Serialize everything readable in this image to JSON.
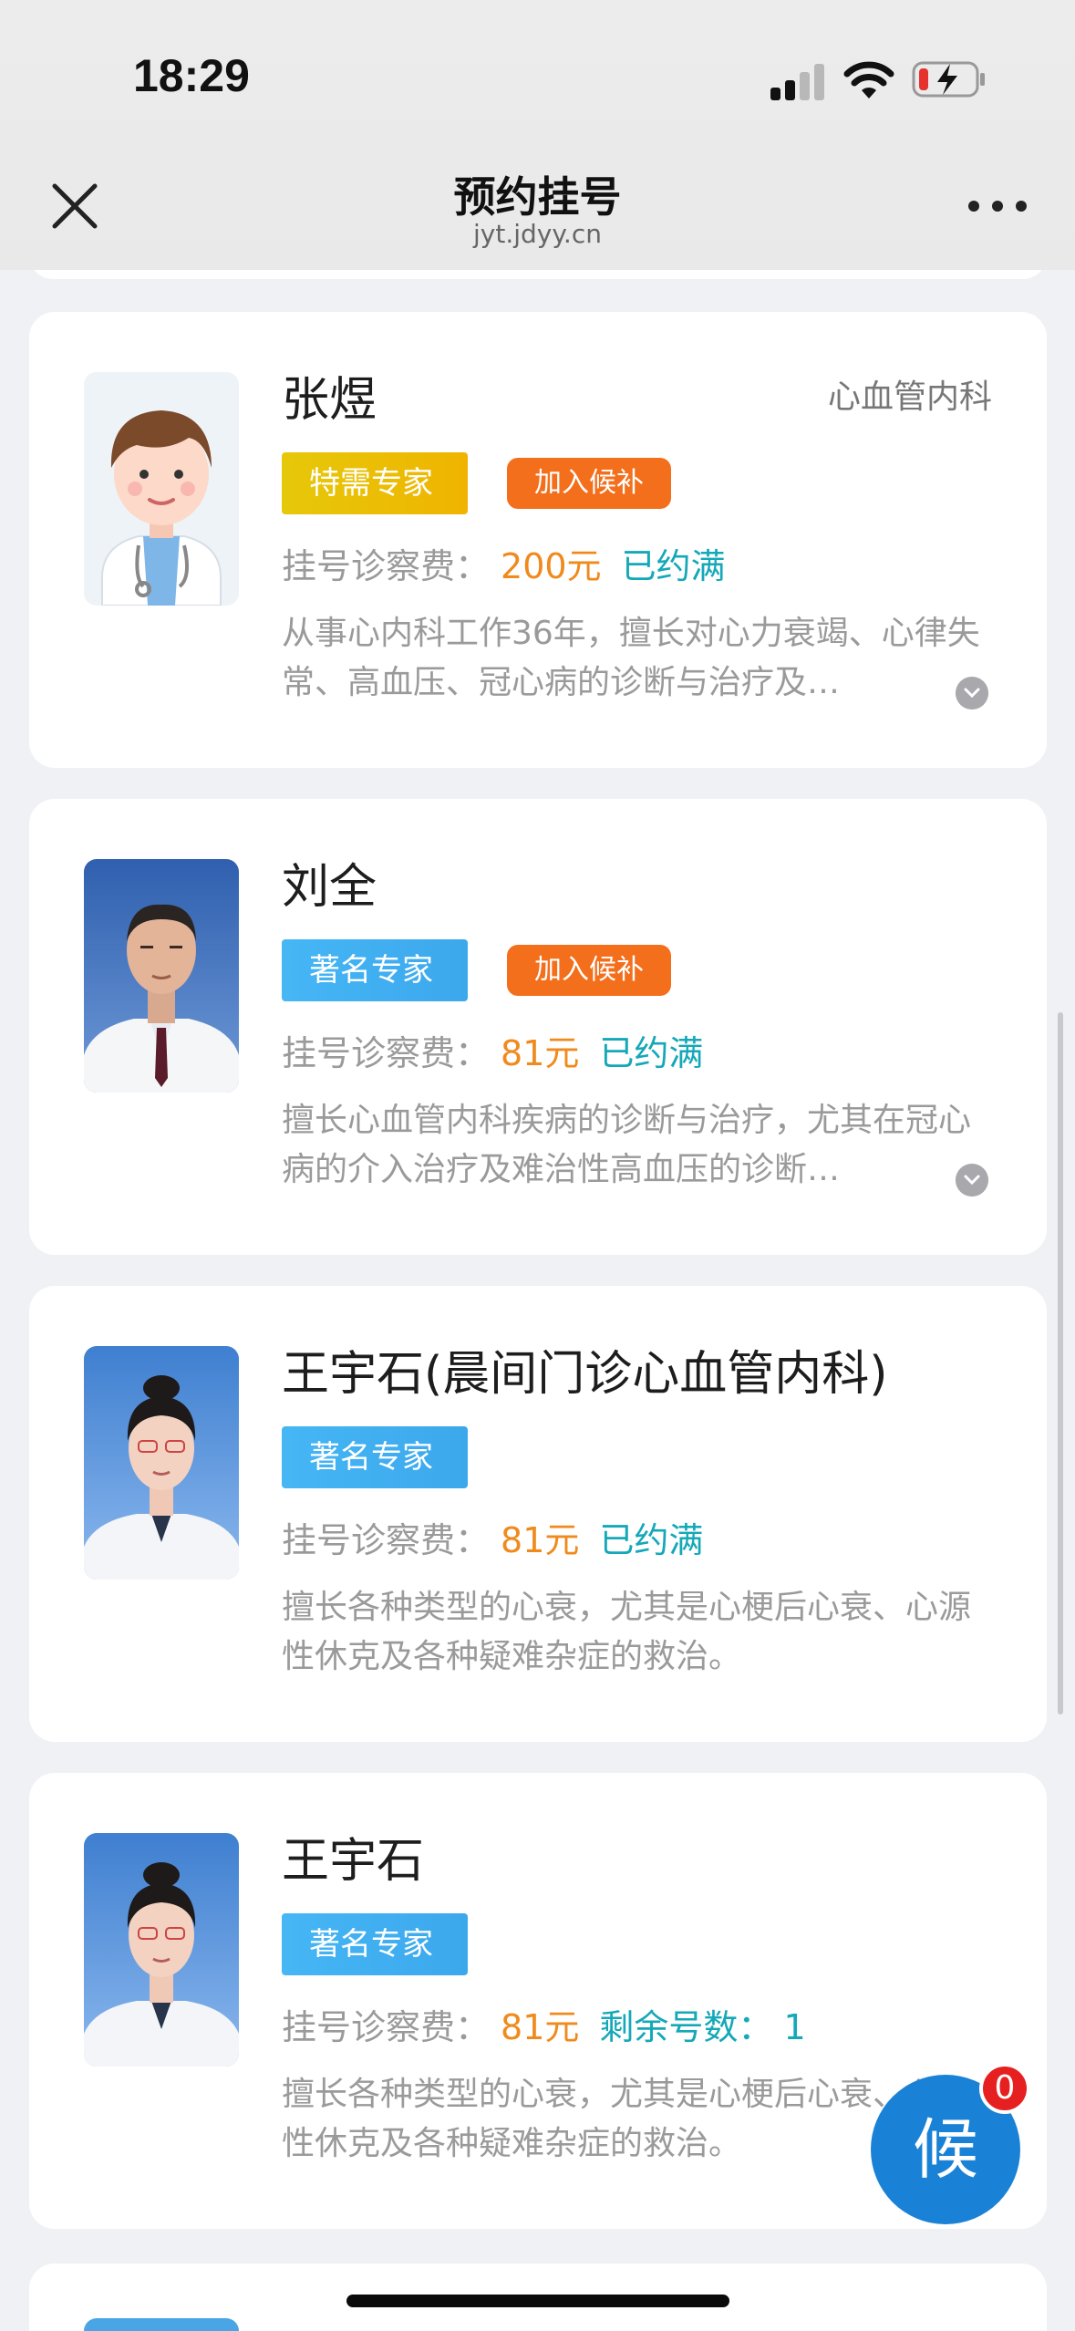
{
  "status_bar": {
    "time": "18:29"
  },
  "nav": {
    "title": "预约挂号",
    "subtitle": "jyt.jdyy.cn"
  },
  "colors": {
    "special_badge": "#f0b400",
    "famous_badge": "#3ba8ec",
    "waitlist_badge": "#f36f1c",
    "fee": "#f08a1c",
    "status": "#14a8b8",
    "fab": "#1a82d6"
  },
  "doctors": [
    {
      "name": "张煜",
      "department": "心血管内科",
      "title_badge": "特需专家",
      "waitlist_label": "加入候补",
      "fee_label": "挂号诊察费：",
      "fee": "200元",
      "status": "已约满",
      "description": "从事心内科工作36年，擅长对心力衰竭、心律失常、高血压、冠心病的诊断与治疗及…",
      "avatar": "cartoon-doctor-icon"
    },
    {
      "name": "刘全",
      "department": "",
      "title_badge": "著名专家",
      "waitlist_label": "加入候补",
      "fee_label": "挂号诊察费：",
      "fee": "81元",
      "status": "已约满",
      "description": "擅长心血管内科疾病的诊断与治疗，尤其在冠心病的介入治疗及难治性高血压的诊断…",
      "avatar": "doctor-photo"
    },
    {
      "name": "王宇石(晨间门诊心血管内科)",
      "department": "",
      "title_badge": "著名专家",
      "fee_label": "挂号诊察费：",
      "fee": "81元",
      "status": "已约满",
      "description": "擅长各种类型的心衰，尤其是心梗后心衰、心源性休克及各种疑难杂症的救治。",
      "avatar": "doctor-photo"
    },
    {
      "name": "王宇石",
      "department": "",
      "title_badge": "著名专家",
      "fee_label": "挂号诊察费：",
      "fee": "81元",
      "status": "剩余号数：  1",
      "description": "擅长各种类型的心衰，尤其是心梗后心衰、心源性休克及各种疑难杂症的救治。",
      "avatar": "doctor-photo"
    }
  ],
  "fab": {
    "label": "候",
    "badge_count": "0"
  }
}
